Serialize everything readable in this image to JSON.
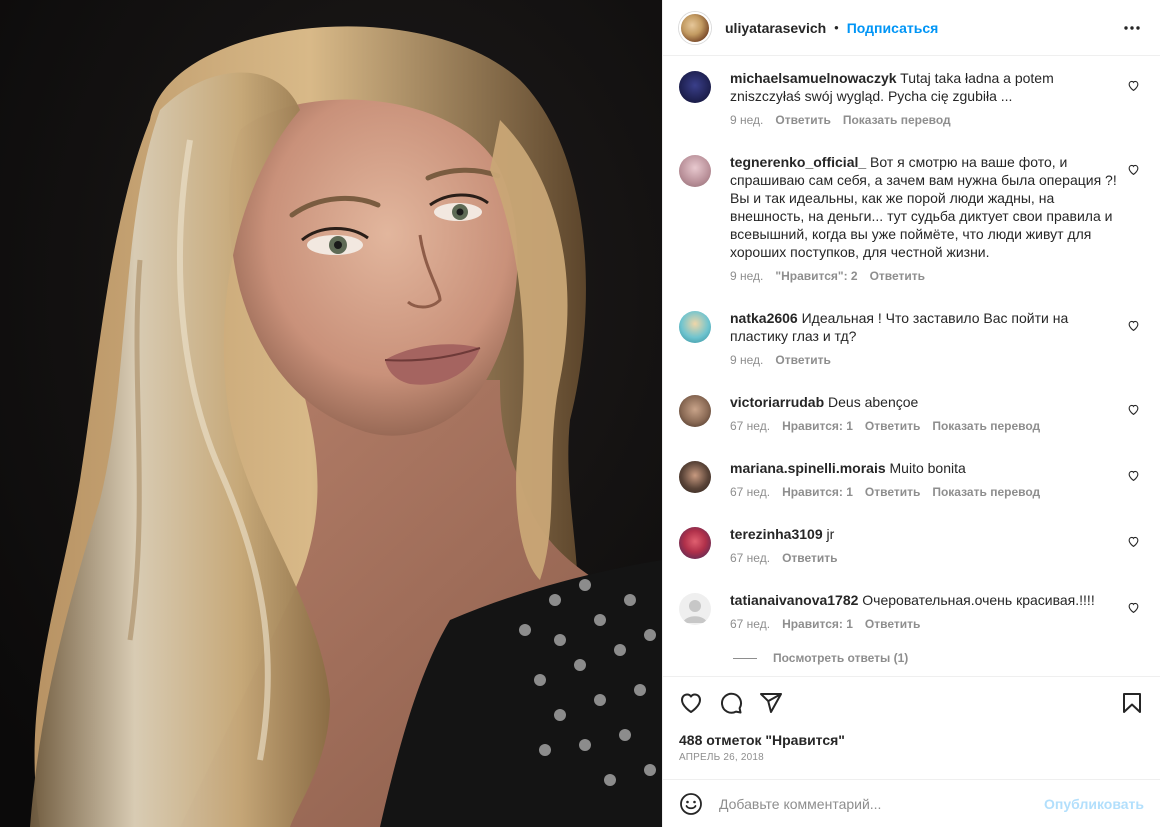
{
  "post": {
    "username": "uliyatarasevich",
    "separator": "•",
    "follow_label": "Подписаться",
    "likes_text": "488 отметок \"Нравится\"",
    "date_text": "АПРЕЛЬ 26, 2018"
  },
  "comments": [
    {
      "user": "michaelsamuelnowaczyk",
      "text": "Tutaj taka ładna a potem zniszczyłaś swój wygląd. Pycha cię zgubiła ...",
      "time": "9 нед.",
      "likes": "",
      "reply": "Ответить",
      "translate": "Показать перевод",
      "avatar_color": "#2c2c54"
    },
    {
      "user": "tegnerenko_official_",
      "text": "Вот я смотрю на ваше фото, и спрашиваю сам себя, а зачем вам нужна была операция ?! Вы и так идеальны, как же порой люди жадны, на внешность, на деньги... тут судьба диктует свои правила и всевышний, когда вы уже поймёте, что люди живут для хороших поступков, для честной жизни.",
      "time": "9 нед.",
      "likes": "\"Нравится\": 2",
      "reply": "Ответить",
      "translate": "",
      "avatar_color": "#c9a7b0"
    },
    {
      "user": "natka2606",
      "text": "Идеальная ! Что заставило Вас пойти на пластику глаз и тд?",
      "time": "9 нед.",
      "likes": "",
      "reply": "Ответить",
      "translate": "",
      "avatar_color": "#4fb8c7"
    },
    {
      "user": "victoriarrudab",
      "text": "Deus abençoe",
      "time": "67 нед.",
      "likes": "Нравится: 1",
      "reply": "Ответить",
      "translate": "Показать перевод",
      "avatar_color": "#8a6a55"
    },
    {
      "user": "mariana.spinelli.morais",
      "text": "Muito bonita",
      "time": "67 нед.",
      "likes": "Нравится: 1",
      "reply": "Ответить",
      "translate": "Показать перевод",
      "avatar_color": "#5a4438"
    },
    {
      "user": "terezinha3109",
      "text": "jr",
      "time": "67 нед.",
      "likes": "",
      "reply": "Ответить",
      "translate": "",
      "avatar_color": "#b0304a"
    },
    {
      "user": "tatianaivanova1782",
      "text": "Очеровательная.очень красивая.!!!!",
      "time": "67 нед.",
      "likes": "Нравится: 1",
      "reply": "Ответить",
      "translate": "",
      "avatar_color": "#e0e0e0"
    }
  ],
  "view_replies": "Посмотреть ответы (1)",
  "add_comment": {
    "placeholder": "Добавьте комментарий...",
    "post_label": "Опубликовать"
  },
  "colors": {
    "accent": "#0095f6",
    "post_disabled": "#b2dffc",
    "meta_gray": "#8e8e8e",
    "text": "#262626"
  },
  "icons": [
    "more-icon",
    "heart-icon",
    "comment-icon",
    "share-icon",
    "bookmark-icon",
    "emoji-icon"
  ]
}
